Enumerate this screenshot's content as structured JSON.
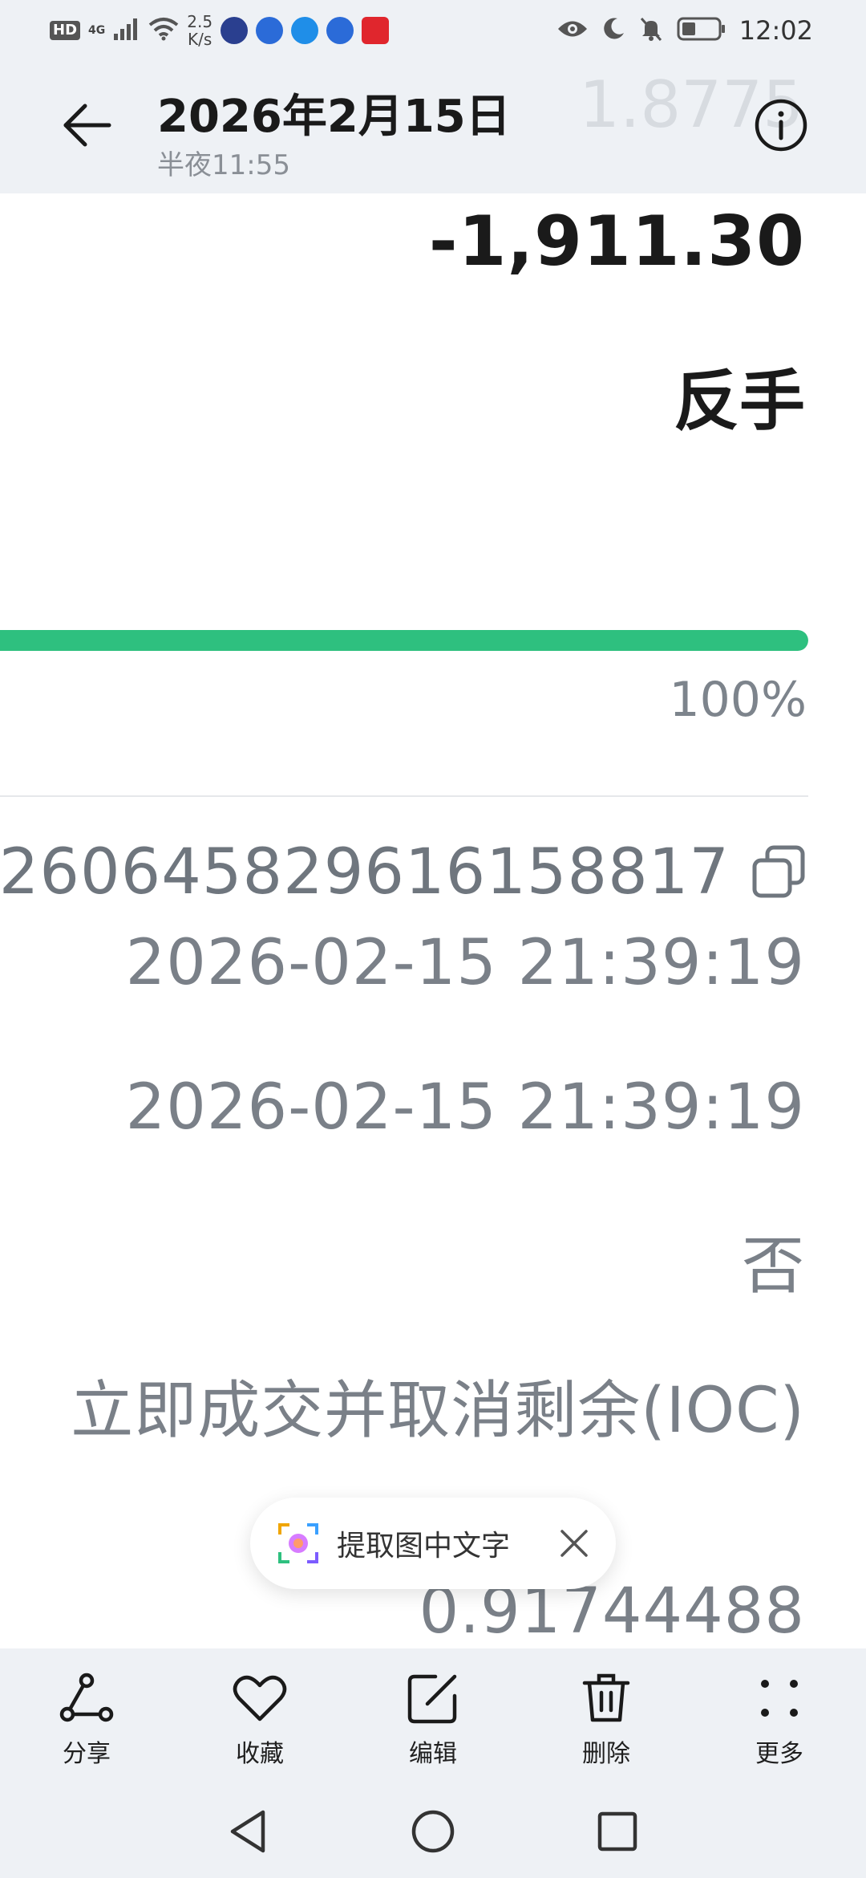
{
  "status_bar": {
    "hd": "HD",
    "network": "4G",
    "speed_value": "2.5",
    "speed_unit": "K/s",
    "time": "12:02",
    "icons": [
      "signal-icon",
      "wifi-icon",
      "app-icon",
      "eye-icon",
      "moon-icon",
      "bell-off-icon",
      "battery-icon"
    ],
    "app_colors": [
      "#2a3f8f",
      "#2b6bd8",
      "#1f8ee8",
      "#2b6bd8",
      "#e0262d"
    ]
  },
  "header": {
    "date": "2026年2月15日",
    "time": "半夜11:55",
    "ghost_value": "1.8775"
  },
  "trade": {
    "amount": "-1,911.30",
    "direction": "反手",
    "progress_percent": 100,
    "progress_label": "100%",
    "progress_color": "#2ec07f",
    "order_id": "2606458296161588​17",
    "created_time": "2026-02-15 21:39:19",
    "updated_time": "2026-02-15 21:39:19",
    "flag_value": "否",
    "time_in_force": "立即成交并取消剩余(IOC)",
    "last_value": "0.91744488"
  },
  "ocr_popup": {
    "label": "提取图中文字"
  },
  "toolbar": {
    "share": "分享",
    "favorite": "收藏",
    "edit": "编辑",
    "delete": "删除",
    "more": "更多"
  }
}
